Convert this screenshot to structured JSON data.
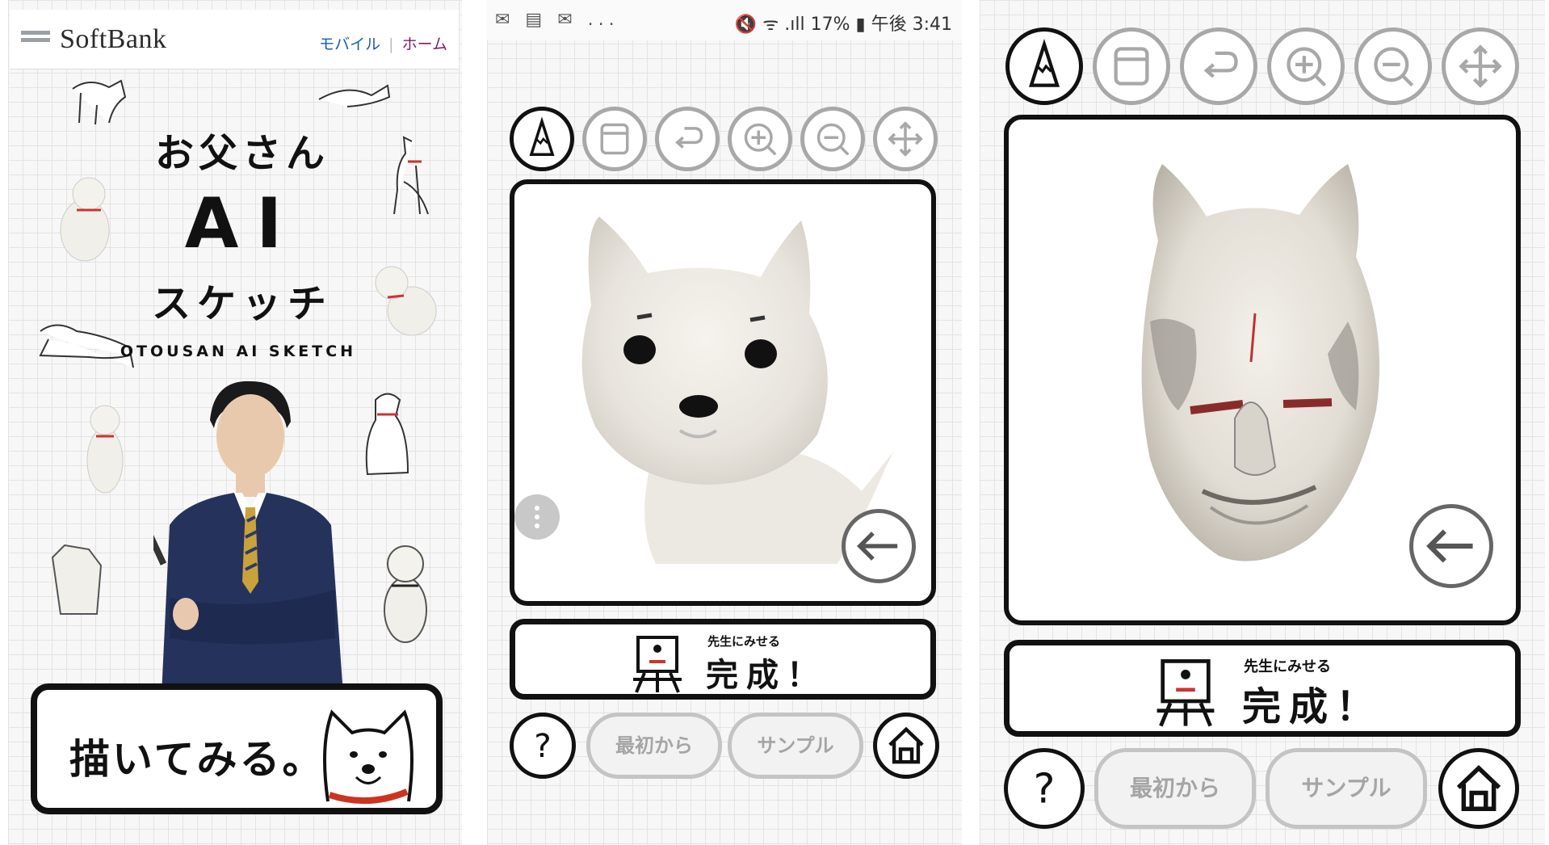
{
  "panel1": {
    "header": {
      "logo": "SoftBank",
      "nav_mobile": "モバイル",
      "nav_home": "ホーム"
    },
    "title": {
      "line1": "お父さん",
      "line2": "AI",
      "line3": "スケッチ",
      "english": "OTOUSAN AI SKETCH"
    },
    "draw_button": "描いてみる。"
  },
  "panel2": {
    "status": {
      "left_icons": "✉ ▤ ✉ ...",
      "right": "🔇 ᯤ .ıll 17% ▮ 午後 3:41"
    },
    "done_button": {
      "sub": "先生にみせる",
      "main": "完成！"
    },
    "help": "?",
    "restart_label": "最初から",
    "sample_label": "サンプル"
  },
  "panel3": {
    "done_button": {
      "sub": "先生にみせる",
      "main": "完成！"
    },
    "help": "?",
    "restart_label": "最初から",
    "sample_label": "サンプル"
  },
  "icons": [
    "pencil-icon",
    "eraser-icon",
    "undo-icon",
    "zoom-in-icon",
    "zoom-out-icon",
    "move-icon",
    "back-arrow-icon",
    "home-icon",
    "easel-icon"
  ]
}
